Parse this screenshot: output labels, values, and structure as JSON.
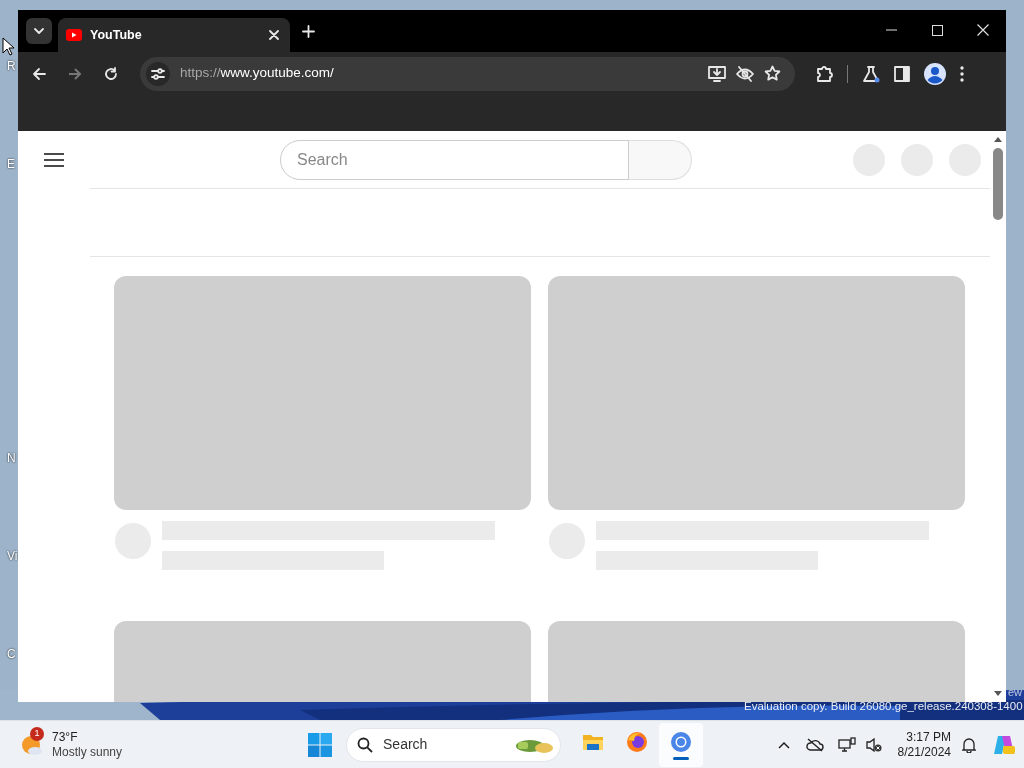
{
  "desktop": {
    "icon_labels": [
      "R",
      "E",
      "N",
      "Vi",
      "C",
      "ew"
    ],
    "watermark": "Evaluation copy. Build 26080.ge_release.240308-1400"
  },
  "browser": {
    "tabs": [
      {
        "title": "YouTube",
        "selected": true
      }
    ],
    "url": {
      "scheme": "https://",
      "rest": "www.youtube.com/"
    }
  },
  "page": {
    "search": {
      "placeholder": "Search"
    },
    "cards": [
      {
        "kind": "skeleton"
      },
      {
        "kind": "skeleton"
      },
      {
        "kind": "thumbnail_only"
      },
      {
        "kind": "thumbnail_only"
      }
    ]
  },
  "taskbar": {
    "weather": {
      "badge": "1",
      "temperature": "73°F",
      "condition": "Mostly sunny"
    },
    "search": {
      "label": "Search"
    },
    "apps": [
      {
        "kind": "files",
        "selected": false
      },
      {
        "kind": "firefox",
        "selected": false
      },
      {
        "kind": "chrome",
        "selected": true
      }
    ],
    "clock": {
      "time": "3:17 PM",
      "date": "8/21/2024"
    }
  }
}
